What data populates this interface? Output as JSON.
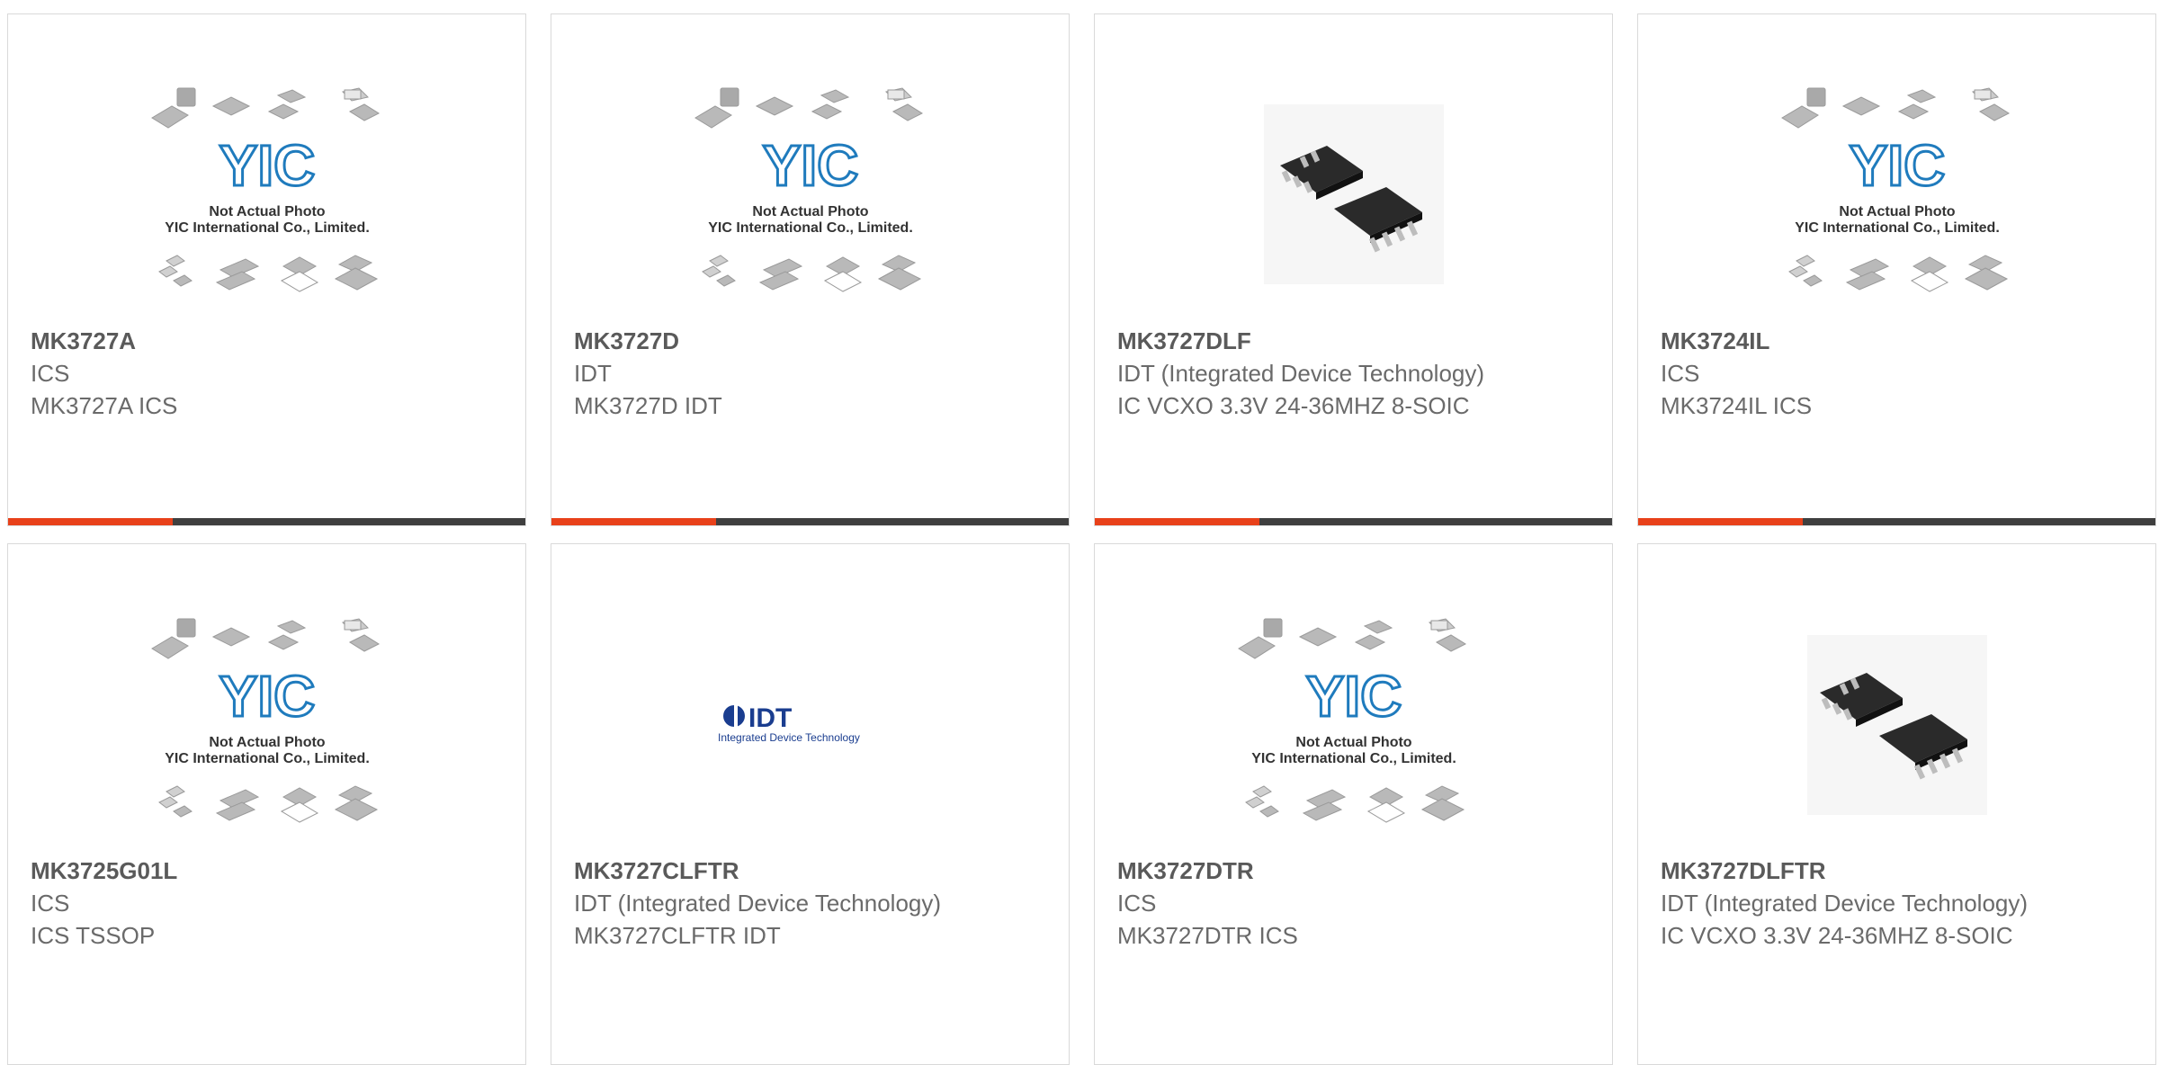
{
  "theme": {
    "accent_color": "#e8411a",
    "bar_color": "#3f3f3f"
  },
  "products": [
    {
      "part": "MK3727A",
      "brand": "ICS",
      "desc": "MK3727A ICS",
      "image": "yic-placeholder-image"
    },
    {
      "part": "MK3727D",
      "brand": "IDT",
      "desc": "MK3727D IDT",
      "image": "yic-placeholder-image"
    },
    {
      "part": "MK3727DLF",
      "brand": "IDT (Integrated Device Technology)",
      "desc": "IC VCXO 3.3V 24-36MHZ 8-SOIC",
      "image": "soic-chip-photo"
    },
    {
      "part": "MK3724IL",
      "brand": "ICS",
      "desc": "MK3724IL ICS",
      "image": "yic-placeholder-image"
    },
    {
      "part": "MK3725G01L",
      "brand": "ICS",
      "desc": "ICS TSSOP",
      "image": "yic-placeholder-image"
    },
    {
      "part": "MK3727CLFTR",
      "brand": "IDT (Integrated Device Technology)",
      "desc": "MK3727CLFTR IDT",
      "image": "idt-logo-image"
    },
    {
      "part": "MK3727DTR",
      "brand": "ICS",
      "desc": "MK3727DTR ICS",
      "image": "yic-placeholder-image"
    },
    {
      "part": "MK3727DLFTR",
      "brand": "IDT (Integrated Device Technology)",
      "desc": "IC VCXO 3.3V 24-36MHZ 8-SOIC",
      "image": "soic-chip-photo"
    }
  ],
  "placeholder": {
    "logo": "YIC",
    "line1": "Not Actual Photo",
    "line2": "YIC International Co., Limited."
  },
  "idt_logo": {
    "mark": "IDT",
    "tagline": "Integrated Device Technology"
  }
}
